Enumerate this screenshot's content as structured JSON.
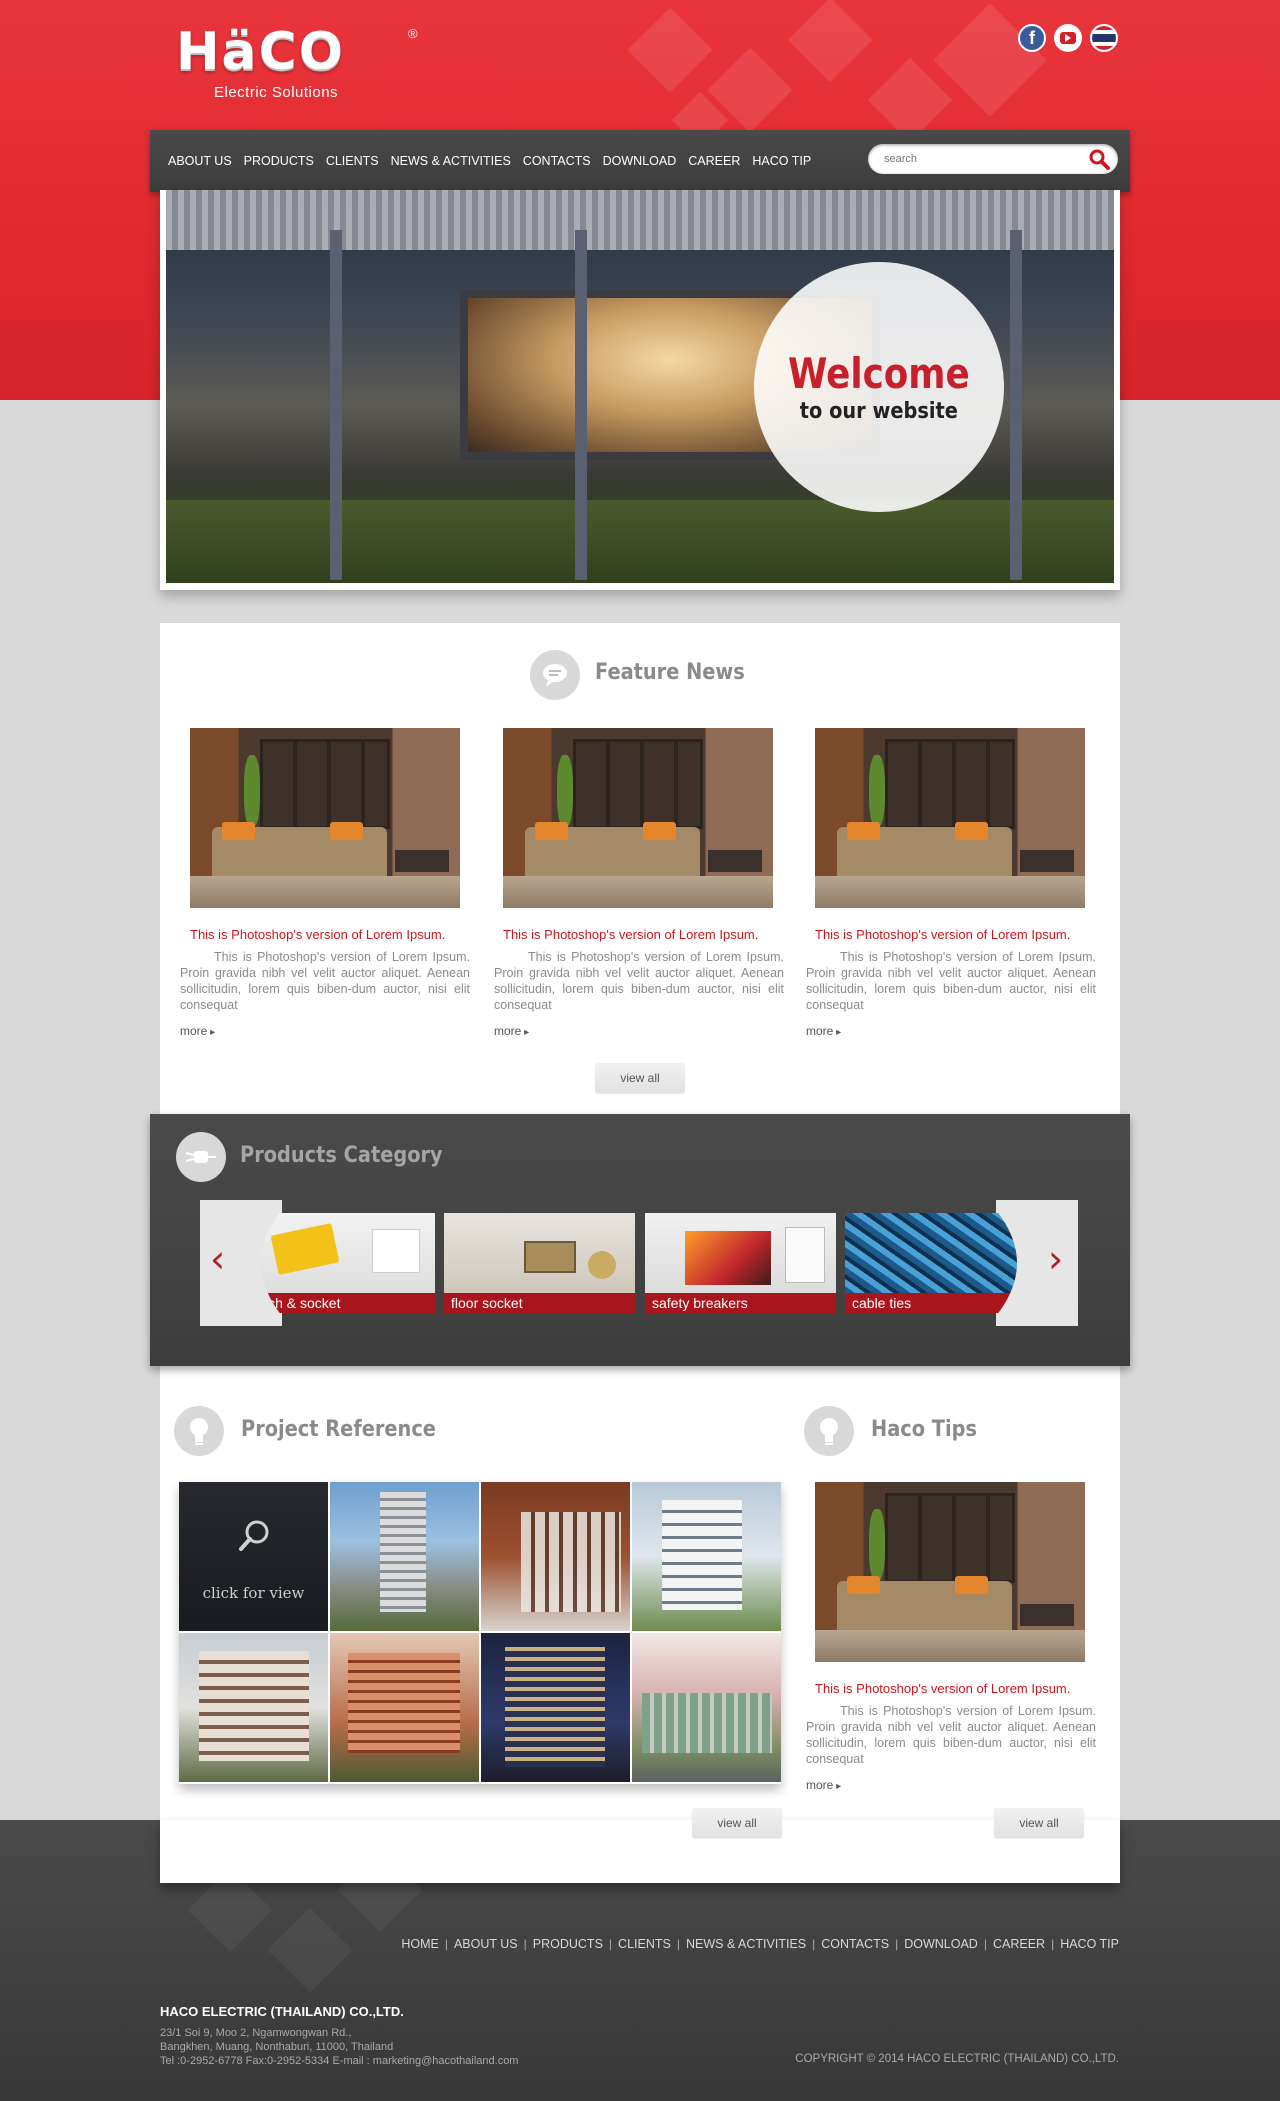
{
  "brand": {
    "logo": "HäCO",
    "registered": "®",
    "tagline": "Electric Solutions"
  },
  "social": {
    "facebook": "f",
    "youtube": "youtube-icon",
    "language": "thai-flag-icon"
  },
  "nav": {
    "items": [
      "ABOUT US",
      "PRODUCTS",
      "CLIENTS",
      "NEWS & ACTIVITIES",
      "CONTACTS",
      "DOWNLOAD",
      "CAREER",
      "HACO TIP"
    ]
  },
  "search": {
    "placeholder": "search"
  },
  "hero": {
    "title": "Welcome",
    "subtitle": "to our website"
  },
  "feature_news": {
    "title": "Feature News",
    "items": [
      {
        "headline": "This is Photoshop's version  of Lorem Ipsum.",
        "body": "This is Photoshop's version  of Lorem Ipsum. Proin gravida nibh vel velit auctor aliquet. Aenean sollicitudin, lorem quis biben-dum auctor, nisi elit consequat",
        "more": "more"
      },
      {
        "headline": "This is Photoshop's version  of Lorem Ipsum.",
        "body": "This is Photoshop's version  of Lorem Ipsum. Proin gravida nibh vel velit auctor aliquet. Aenean sollicitudin, lorem quis biben-dum auctor, nisi elit consequat",
        "more": "more"
      },
      {
        "headline": "This is Photoshop's version  of Lorem Ipsum.",
        "body": "This is Photoshop's version  of Lorem Ipsum. Proin gravida nibh vel velit auctor aliquet. Aenean sollicitudin, lorem quis biben-dum auctor, nisi elit consequat",
        "more": "more"
      }
    ],
    "view_all": "view all"
  },
  "products": {
    "title": "Products Category",
    "items": [
      "witch & socket",
      "floor socket",
      "safety breakers",
      "cable ties"
    ],
    "prev": "‹",
    "next": "›"
  },
  "projects": {
    "title": "Project Reference",
    "hover_label": "click for view",
    "view_all": "view all"
  },
  "tips": {
    "title": "Haco Tips",
    "headline": "This is Photoshop's version  of Lorem Ipsum.",
    "body": "This is Photoshop's version  of Lorem Ipsum. Proin gravida nibh vel velit auctor aliquet. Aenean sollicitudin, lorem quis biben-dum auctor, nisi elit consequat",
    "more": "more",
    "view_all": "view all"
  },
  "footer": {
    "links": [
      "HOME",
      "ABOUT US",
      "PRODUCTS",
      "CLIENTS",
      "NEWS & ACTIVITIES",
      "CONTACTS",
      "DOWNLOAD",
      "CAREER",
      "HACO TIP"
    ],
    "company": "HACO ELECTRIC (THAILAND) CO.,LTD.",
    "address_line1": "23/1 Soi 9, Moo 2, Ngamwongwan Rd.,",
    "address_line2": "Bangkhen, Muang, Nonthaburi, 11000, Thailand",
    "address_line3": "Tel :0-2952-6778 Fax:0-2952-5334 E-mail : marketing@hacothailand.com",
    "copyright": "COPYRIGHT © 2014 HACO ELECTRIC (THAILAND) CO.,LTD."
  },
  "colors": {
    "brand_red": "#e02a30",
    "dark_bar": "#444444",
    "accent_red_text": "#d0151d"
  }
}
